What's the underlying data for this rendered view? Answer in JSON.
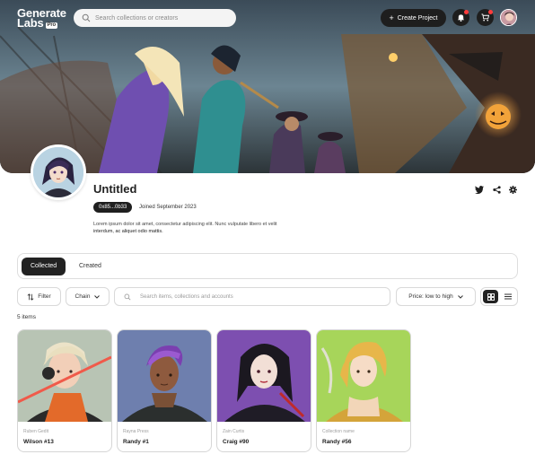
{
  "topbar": {
    "logo_line1": "Generate",
    "logo_line2": "Labs",
    "logo_badge": "Pro",
    "search_placeholder": "Search collections or creators",
    "create_label": "Create Project",
    "icons": [
      "bell-icon",
      "cart-icon"
    ]
  },
  "profile": {
    "name": "Untitled",
    "address": "0x85...0b33",
    "joined": "Joined September 2023",
    "bio_line1": "Lorem ipsum dolor sit amet, consectetur adipiscing elit. Nunc vulputate libero et velit",
    "bio_line2": "interdum, ac aliquet odio mattis.",
    "social_icons": [
      "twitter-icon",
      "share-icon",
      "settings-icon"
    ]
  },
  "tabs": [
    {
      "label": "Collected",
      "active": true
    },
    {
      "label": "Created",
      "active": false
    }
  ],
  "filters": {
    "filter_label": "Filter",
    "chain_label": "Chain",
    "search_placeholder": "Search items, collections and accounts",
    "sort_label": "Price: low to high"
  },
  "item_count": "5 items",
  "cards": [
    {
      "collection": "Ruben Gedit",
      "name": "Wilson #13",
      "bg": "#a7b7a7"
    },
    {
      "collection": "Rayna Press",
      "name": "Randy #1",
      "bg": "#6b7aa8"
    },
    {
      "collection": "Zain Curtis",
      "name": "Craig #90",
      "bg": "#7a4aa8"
    },
    {
      "collection": "Collection name",
      "name": "Randy #56",
      "bg": "#a6d35a"
    }
  ],
  "colors": {
    "accent": "#1e1e1e",
    "notification": "#ff3b3b"
  }
}
